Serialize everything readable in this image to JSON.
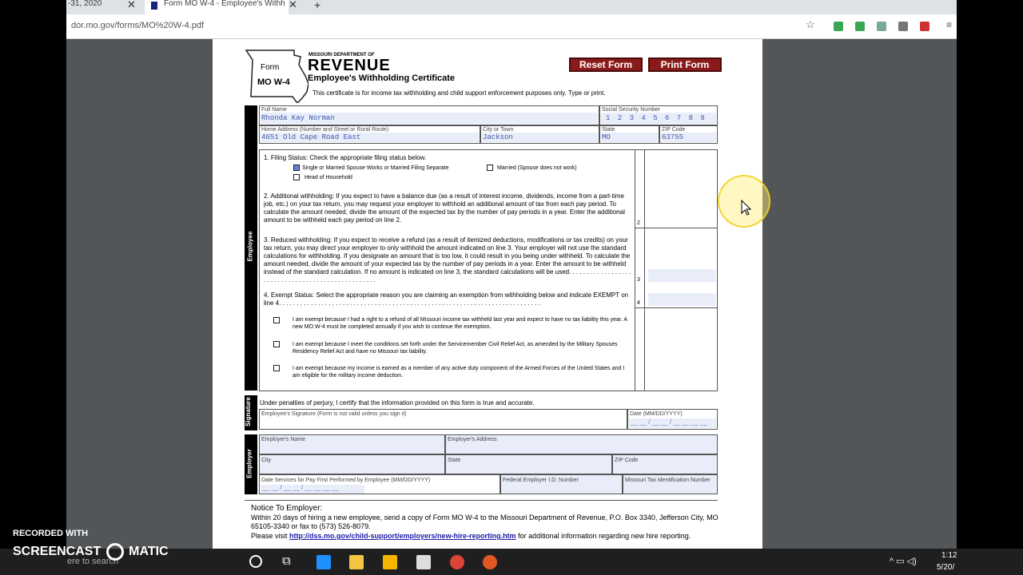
{
  "browser": {
    "tab_prev_label": "-31, 2020",
    "tab_active_label": "Form MO W-4 - Employee's Withh",
    "new_tab_symbol": "+",
    "url": "dor.mo.gov/forms/MO%20W-4.pdf"
  },
  "form": {
    "agency_small": "MISSOURI DEPARTMENT OF",
    "agency_big": "REVENUE",
    "form_label": "Form",
    "form_number": "MO W-4",
    "title": "Employee's Withholding Certificate",
    "subtitle": "This certificate is for income tax withholding and child support enforcement purposes only. Type or print.",
    "reset_button": "Reset Form",
    "print_button": "Print Form",
    "fields": {
      "full_name_label": "Full Name",
      "full_name": "Rhonda Kay Norman",
      "ssn_label": "Social Security Number",
      "ssn": "1 2 3 4 5 6 7 8 9",
      "address_label": "Home Address (Number and Street or Rural Route)",
      "address": "4651 Old Cape Road East",
      "city_label": "City or Town",
      "city": "Jackson",
      "state_label": "State",
      "state": "MO",
      "zip_label": "ZIP Code",
      "zip": "63755"
    },
    "employee_section": "Employee",
    "line1_heading": "1.  Filing Status: Check the appropriate filing status below.",
    "line1_opt_single": "Single or Married Spouse Works or Married Filing Separate",
    "line1_opt_married": "Married (Spouse does not work)",
    "line1_opt_hoh": "Head of Household",
    "line2_text": "2.  Additional withholding: If you expect to have a balance due (as a result of interest income, dividends, income from a part-time job, etc.) on your tax return, you may request your employer to withhold an additional amount of tax from each pay period. To calculate the amount needed, divide the amount of the expected tax by the number of pay periods in a year. Enter the additional amount to be withheld each pay period on line 2.",
    "line2_num": "2",
    "line3_text": "3.  Reduced withholding: If you expect to receive a refund (as a result of itemized deductions, modifications or tax credits) on your tax return, you may direct your employer to only withhold the amount indicated on line 3. Your employer will not use the standard calculations for withholding. If you designate an amount that is too low, it could result in you being under withheld. To calculate the amount needed, divide the amount of your expected tax by the number of pay periods in a year. Enter the amount to be withheld instead of the standard calculation. If no amount is indicated on line 3, the standard calculations will be used. . . . . . . . . . . . . . . . . . . . . . . . . . . . . . . . . . . . . . . . . . . . . . . . . .",
    "line3_num": "3",
    "line4_text": "4.  Exempt Status: Select the appropriate reason you are claiming an exemption from withholding below and indicate EXEMPT on line 4. . . . . . . . . . . . . . . . . . . . . . . . . . . . . . . . . . . . . . . . . . . . . . . . . . . . . . . . . . . . . . . . . . . . . . . . . .",
    "line4_num": "4",
    "exempt_1": "I am exempt because I had a right to a refund of all Missouri income tax withheld last year and expect to have no tax liability this year. A new MO W-4 must be completed annually if you wish to continue the exemption.",
    "exempt_2": "I am exempt because I meet the conditions set forth under the Servicemember Civil Relief Act, as amended by the Military Spouses Residency Relief Act and have no Missouri tax liability.",
    "exempt_3": "I am exempt because my income is earned as a member of any active duty component of the Armed Forces of the United States and I am eligible for the military income deduction.",
    "signature_section": "Signature",
    "perjury_text": "Under penalties of perjury, I certify that the information provided on this form is true and accurate.",
    "signature_label": "Employee's Signature (Form is not valid unless you sign it)",
    "date_label": "Date (MM/DD/YYYY)",
    "date_placeholder": "__ __ / __ __ / __ __ __ __",
    "employer_section": "Employer",
    "employer_name_label": "Employer's Name",
    "employer_address_label": "Employer's Address",
    "employer_city_label": "City",
    "employer_state_label": "State",
    "employer_zip_label": "ZIP Code",
    "date_services_label": "Date Services for Pay First Performed by Employee (MM/DD/YYYY)",
    "date_services_placeholder": "__ __ / __ __ / __ __ __ __",
    "fein_label": "Federal Employer I.D. Number",
    "mo_tax_id_label": "Missouri Tax Identification Number",
    "notice_heading": "Notice To Employer:",
    "notice_text": "Within 20 days of hiring a new employee, send a copy of Form MO W-4 to the Missouri Department of Revenue, P.O. Box 3340, Jefferson City, MO 65105-3340 or fax to (573) 526-8079.",
    "notice_visit": "Please visit",
    "notice_link": "http://dss.mo.gov/child-support/employers/new-hire-reporting.htm",
    "notice_after": "for additional information regarding new hire reporting."
  },
  "taskbar": {
    "search_text": "ere to search",
    "time": "1:12",
    "date": "5/20/"
  },
  "watermark": {
    "line1": "RECORDED WITH",
    "line2_left": "SCREENCAST",
    "line2_right": "MATIC"
  }
}
